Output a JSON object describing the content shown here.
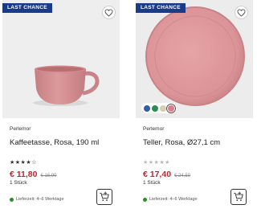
{
  "products": [
    {
      "badge": "LAST CHANCE",
      "brand": "Perlemor",
      "title": "Kaffeetasse, Rosa, 190 ml",
      "rating_filled": 4,
      "rating_stars": "★★★★☆",
      "price": "€ 11,80",
      "old_price": "€ 16,90",
      "unit": "1 Stück",
      "delivery": "Lieferzeit: 4–6 Werktage"
    },
    {
      "badge": "LAST CHANCE",
      "brand": "Perlemor",
      "title": "Teller, Rosa, Ø27,1 cm",
      "rating_filled": 0,
      "rating_stars": "★★★★★",
      "price": "€ 17,40",
      "old_price": "€ 24,50",
      "unit": "1 Stück",
      "delivery": "Lieferzeit: 4–6 Werktage",
      "swatches": [
        "#2f5fa8",
        "#2f8a54",
        "#d9ccb0",
        "#e07b8d"
      ]
    }
  ],
  "colors": {
    "badge_bg": "#1a3a8a",
    "price": "#c8202e",
    "delivery_dot": "#2a8c2a",
    "product_pink": "#d98f92"
  },
  "icons": [
    "heart-icon",
    "cart-add-icon"
  ]
}
